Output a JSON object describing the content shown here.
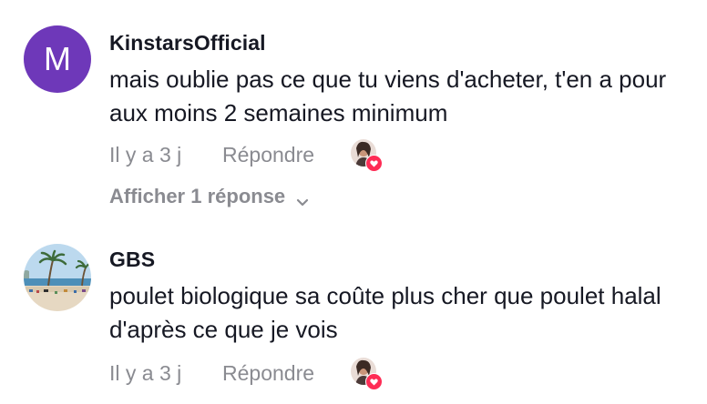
{
  "comments": [
    {
      "avatar_letter": "M",
      "avatar_color": "#6e38b9",
      "username": "KinstarsOfficial",
      "text": "mais oublie pas ce que tu viens d'acheter, t'en a pour aux moins 2 semaines minimum",
      "time": "Il y a 3 j",
      "reply_label": "Répondre",
      "show_replies_label": "Afficher 1 réponse",
      "liked_by_creator": true
    },
    {
      "avatar_letter": "",
      "username": "GBS",
      "text": "poulet biologique sa coûte plus cher que poulet halal d'après ce que je vois",
      "time": "Il y a 3 j",
      "reply_label": "Répondre",
      "liked_by_creator": true
    }
  ],
  "icons": {
    "liked_badge": "heart-icon",
    "expand": "chevron-down-icon"
  },
  "colors": {
    "primary_text": "#161823",
    "secondary_text": "#8a8b91",
    "heart": "#fe2c55"
  }
}
